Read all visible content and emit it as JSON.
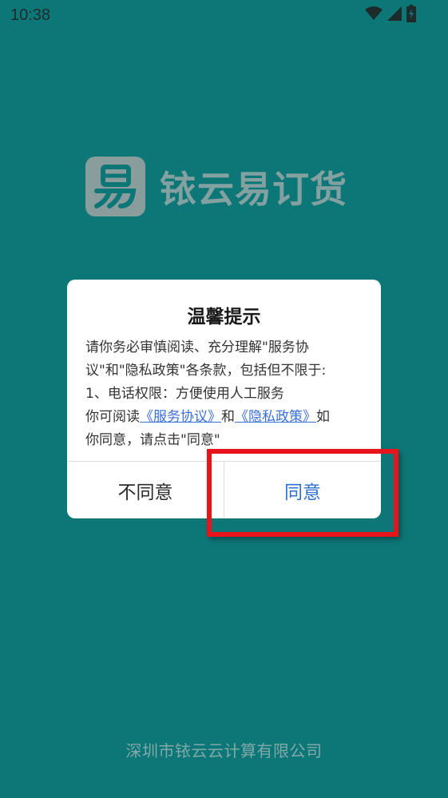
{
  "status_bar": {
    "time": "10:38",
    "icons": [
      "wifi-icon",
      "signal-icon",
      "battery-charging-icon"
    ]
  },
  "app": {
    "name": "铱云易订货",
    "logo_glyph": "易",
    "company": "深圳市铱云云计算有限公司"
  },
  "dialog": {
    "title": "温馨提示",
    "line1": "请你务必审慎阅读、充分理解\"服务协",
    "line2": "议\"和\"隐私政策\"各条款，包括但不限于:",
    "line3": "1、电话权限：方便使用人工服务",
    "line4_prefix": "你可阅读",
    "service_link": "《服务协议》",
    "and_text": "和",
    "privacy_link": "《隐私政策》",
    "line4_suffix": "如",
    "line5": "你同意，请点击\"同意\"",
    "decline_label": "不同意",
    "agree_label": "同意"
  },
  "colors": {
    "background": "#0d7677",
    "link": "#3a6fd8",
    "agree": "#2f6fd0",
    "highlight": "#e8141b"
  }
}
